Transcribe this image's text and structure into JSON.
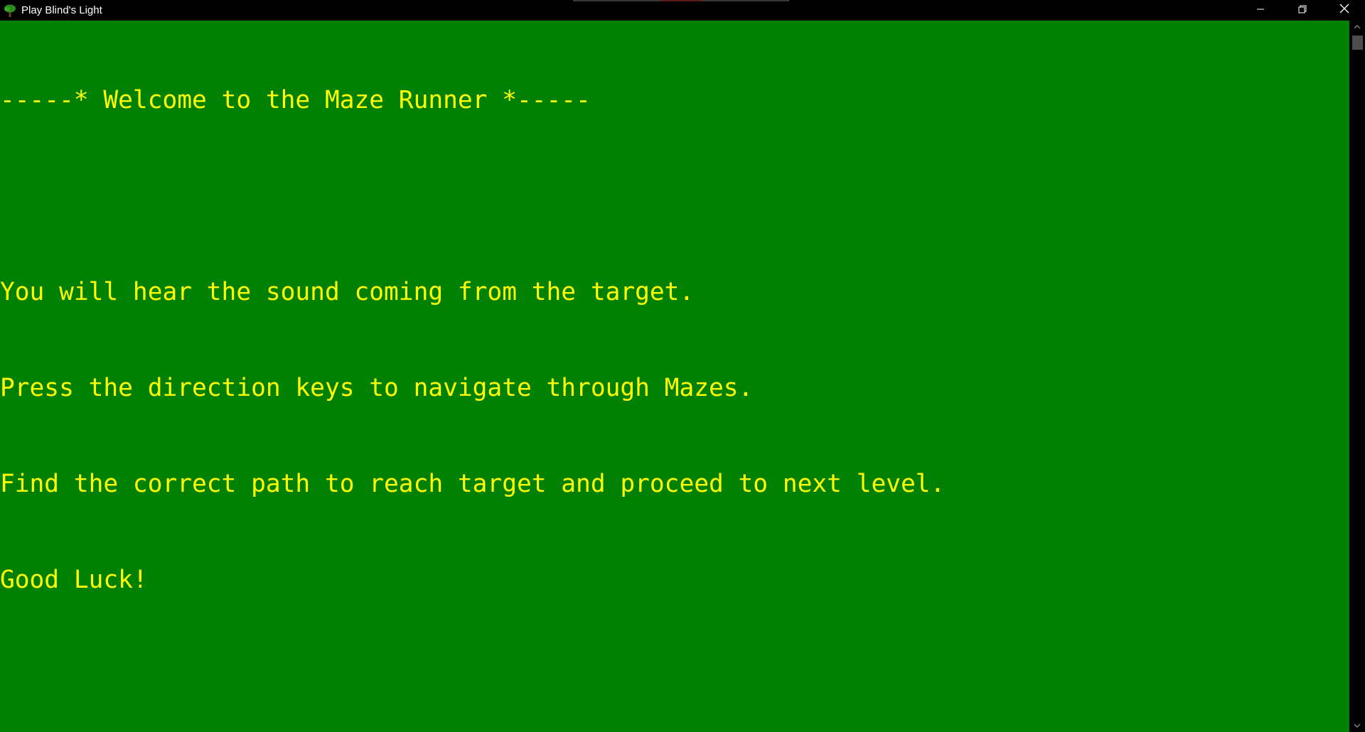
{
  "window": {
    "title": "Play Blind's Light",
    "icon": "tree-icon",
    "controls": {
      "minimize_icon": "minimize-icon",
      "restore_icon": "restore-icon",
      "close_icon": "close-icon"
    }
  },
  "console": {
    "background_color": "#008000",
    "text_color": "#ffff00",
    "lines": [
      "-----* Welcome to the Maze Runner *-----",
      "",
      "You will hear the sound coming from the target.",
      "Press the direction keys to navigate through Mazes.",
      "Find the correct path to reach target and proceed to next level.",
      "Good Luck!"
    ]
  },
  "scrollbar": {
    "up_icon": "scroll-up-arrow-icon",
    "down_icon": "scroll-down-arrow-icon"
  }
}
